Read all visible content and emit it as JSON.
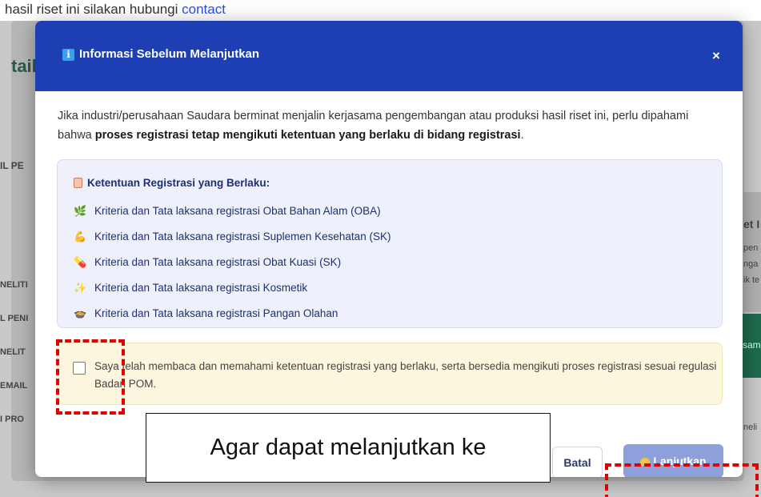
{
  "background": {
    "top_text": "hasil riset ini silakan hubungi",
    "top_link": "contact",
    "detail_title": "tail",
    "side_labels": [
      "IL PE",
      "NELITI",
      "L PENI",
      "NELIT",
      "EMAIL",
      "I PRO"
    ],
    "right_labels": [
      "et I",
      "pen",
      "nga",
      "ik te",
      "neli"
    ],
    "right_button": "sam"
  },
  "modal": {
    "icon": "info-icon",
    "title": "Informasi Sebelum Melanjutkan",
    "close_label": "×",
    "intro_text": "Jika industri/perusahaan Saudara berminat menjalin kerjasama pengembangan atau produksi hasil riset ini, perlu dipahami bahwa ",
    "intro_bold": "proses registrasi tetap mengikuti ketentuan yang berlaku di bidang registrasi",
    "intro_end": ".",
    "regulations": {
      "title_icon": "clipboard-icon",
      "title": "Ketentuan Registrasi yang Berlaku:",
      "items": [
        {
          "icon": "herb-icon",
          "glyph": "🌿",
          "label": "Kriteria dan Tata laksana registrasi Obat Bahan Alam (OBA)"
        },
        {
          "icon": "flexed-arm-icon",
          "glyph": "💪",
          "label": "Kriteria dan Tata laksana registrasi Suplemen Kesehatan (SK)"
        },
        {
          "icon": "pill-icon",
          "glyph": "💊",
          "label": "Kriteria dan Tata laksana registrasi Obat Kuasi (SK)"
        },
        {
          "icon": "sparkles-icon",
          "glyph": "✨",
          "label": "Kriteria dan Tata laksana registrasi Kosmetik"
        },
        {
          "icon": "food-bowl-icon",
          "glyph": "🍲",
          "label": "Kriteria dan Tata laksana registrasi Pangan Olahan"
        }
      ]
    },
    "agreement": {
      "checked": false,
      "text": "Saya telah membaca dan memahami ketentuan registrasi yang berlaku, serta bersedia mengikuti proses registrasi sesuai regulasi Badan POM."
    },
    "buttons": {
      "cancel_label": "Batal",
      "continue_label": "Lanjutkan",
      "continue_icon": "heart-icon"
    }
  },
  "annotation": {
    "caption": "Agar dapat melanjutkan ke",
    "highlight_color": "#e00000"
  }
}
